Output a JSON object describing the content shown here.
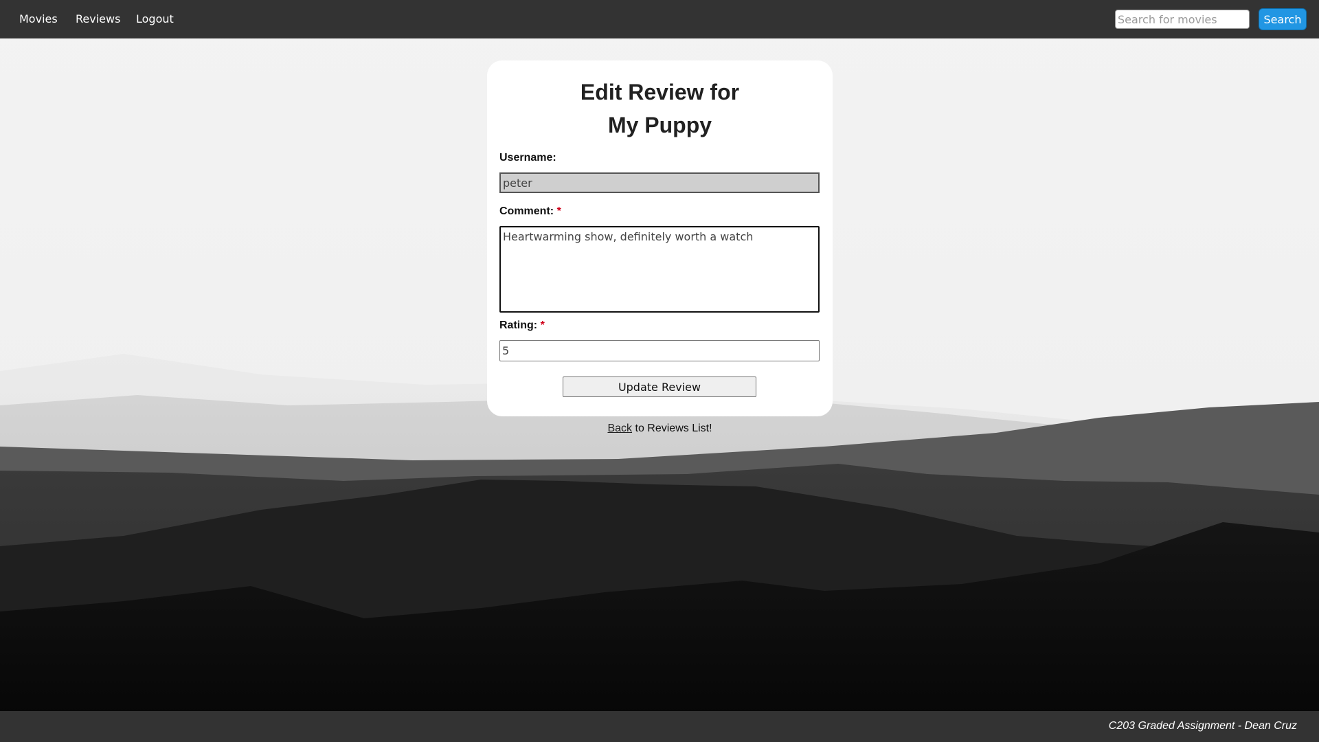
{
  "nav": {
    "links": [
      "Movies",
      "Reviews",
      "Logout"
    ],
    "search_placeholder": "Search for movies",
    "search_label": "Search"
  },
  "form": {
    "title_line1": "Edit Review for",
    "title_line2": "My Puppy",
    "username_label": "Username:",
    "username_value": "peter",
    "comment_label": "Comment:",
    "comment_value": "Heartwarming show, definitely worth a watch",
    "rating_label": "Rating:",
    "rating_value": "5",
    "required_mark": "*",
    "submit_label": "Update Review"
  },
  "back": {
    "link_text": "Back",
    "rest_text": " to Reviews List!"
  },
  "footer": {
    "text": "C203 Graded Assignment - Dean Cruz"
  },
  "colors": {
    "navbar": "#333333",
    "search_button": "#2196e3",
    "required": "#d0021b"
  }
}
